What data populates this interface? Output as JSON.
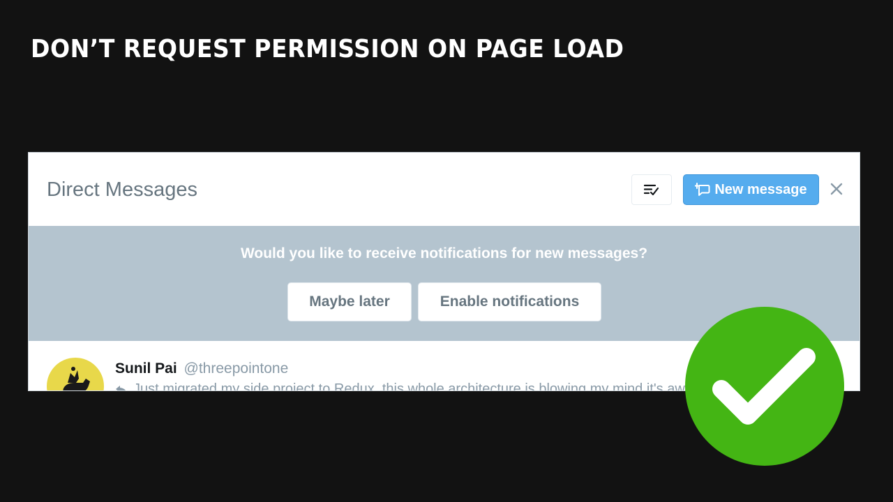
{
  "slide": {
    "title": "DON’T REQUEST PERMISSION ON PAGE LOAD"
  },
  "dm": {
    "title": "Direct Messages",
    "new_message_label": "New message",
    "icons": {
      "mark_read": "checklist-icon",
      "new_message": "new-message-icon",
      "close": "close-icon"
    }
  },
  "banner": {
    "question": "Would you like to receive notifications for new messages?",
    "maybe_later_label": "Maybe later",
    "enable_label": "Enable notifications"
  },
  "conversation": {
    "name": "Sunil Pai",
    "handle": "@threepointone",
    "preview": "Just migrated my side project to Redux, this whole architecture is blowing my mind it's awesome"
  },
  "badge": {
    "icon": "check-icon",
    "color": "#44b514"
  },
  "colors": {
    "background": "#121212",
    "accent": "#55acee",
    "banner": "#b4c4cf",
    "muted_text": "#66757f"
  }
}
